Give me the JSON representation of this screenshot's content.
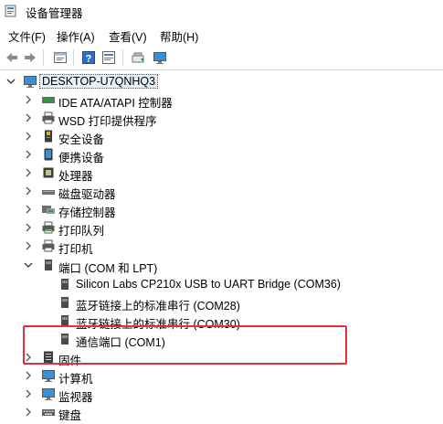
{
  "window": {
    "title": "设备管理器"
  },
  "menu": [
    "文件(F)",
    "操作(A)",
    "查看(V)",
    "帮助(H)"
  ],
  "toolbar": [
    "back-icon",
    "forward-icon",
    "properties-icon",
    "help-icon",
    "show-hidden-icon",
    "update-driver-icon",
    "monitor-icon"
  ],
  "tree": {
    "root": "DESKTOP-U7QNHQ3",
    "items": [
      {
        "label": "IDE ATA/ATAPI 控制器",
        "icon": "ide-controller-icon"
      },
      {
        "label": "WSD 打印提供程序",
        "icon": "printer-icon"
      },
      {
        "label": "安全设备",
        "icon": "security-device-icon"
      },
      {
        "label": "便携设备",
        "icon": "portable-device-icon"
      },
      {
        "label": "处理器",
        "icon": "processor-icon"
      },
      {
        "label": "磁盘驱动器",
        "icon": "disk-drive-icon"
      },
      {
        "label": "存储控制器",
        "icon": "storage-controller-icon"
      },
      {
        "label": "打印队列",
        "icon": "print-queue-icon"
      },
      {
        "label": "打印机",
        "icon": "printer-icon"
      }
    ],
    "ports": {
      "label": "端口 (COM 和 LPT)",
      "children": [
        "Silicon Labs CP210x USB to UART Bridge (COM36)",
        "蓝牙链接上的标准串行 (COM28)",
        "蓝牙链接上的标准串行 (COM30)",
        "通信端口 (COM1)"
      ]
    },
    "after": [
      {
        "label": "固件",
        "icon": "firmware-icon"
      },
      {
        "label": "计算机",
        "icon": "computer-icon"
      },
      {
        "label": "监视器",
        "icon": "monitor-icon"
      },
      {
        "label": "键盘",
        "icon": "keyboard-icon"
      }
    ]
  }
}
